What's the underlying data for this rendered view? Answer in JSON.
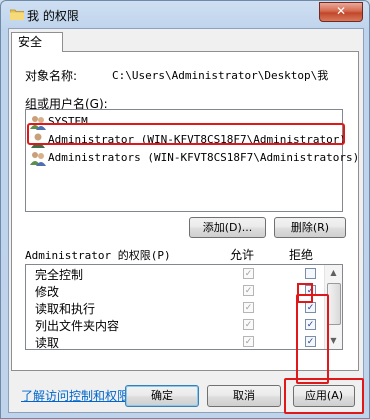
{
  "window": {
    "title": "我 的权限",
    "close_label": "✕"
  },
  "tab": {
    "label": "安全"
  },
  "object": {
    "label": "对象名称:",
    "value": "C:\\Users\\Administrator\\Desktop\\我"
  },
  "group": {
    "label": "组或用户名(G):",
    "items": [
      {
        "name": "SYSTEM",
        "icon": "users-group-icon"
      },
      {
        "name": "Administrator (WIN-KFVT8CS18F7\\Administrator)",
        "icon": "user-icon"
      },
      {
        "name": "Administrators (WIN-KFVT8CS18F7\\Administrators)",
        "icon": "users-group-icon"
      }
    ]
  },
  "buttons": {
    "add": "添加(D)...",
    "remove": "删除(R)"
  },
  "permissions": {
    "header": "Administrator 的权限(P)",
    "allow_label": "允许",
    "deny_label": "拒绝",
    "rows": [
      {
        "name": "完全控制",
        "allow": true,
        "deny": false
      },
      {
        "name": "修改",
        "allow": true,
        "deny": true
      },
      {
        "name": "读取和执行",
        "allow": true,
        "deny": true
      },
      {
        "name": "列出文件夹内容",
        "allow": true,
        "deny": true
      },
      {
        "name": "读取",
        "allow": true,
        "deny": true
      }
    ]
  },
  "link": "了解访问控制和权限",
  "footer": {
    "ok": "确定",
    "cancel": "取消",
    "apply": "应用(A)"
  },
  "colors": {
    "highlight": "#e0181a",
    "link": "#0066cc",
    "close": "#c2472b"
  }
}
